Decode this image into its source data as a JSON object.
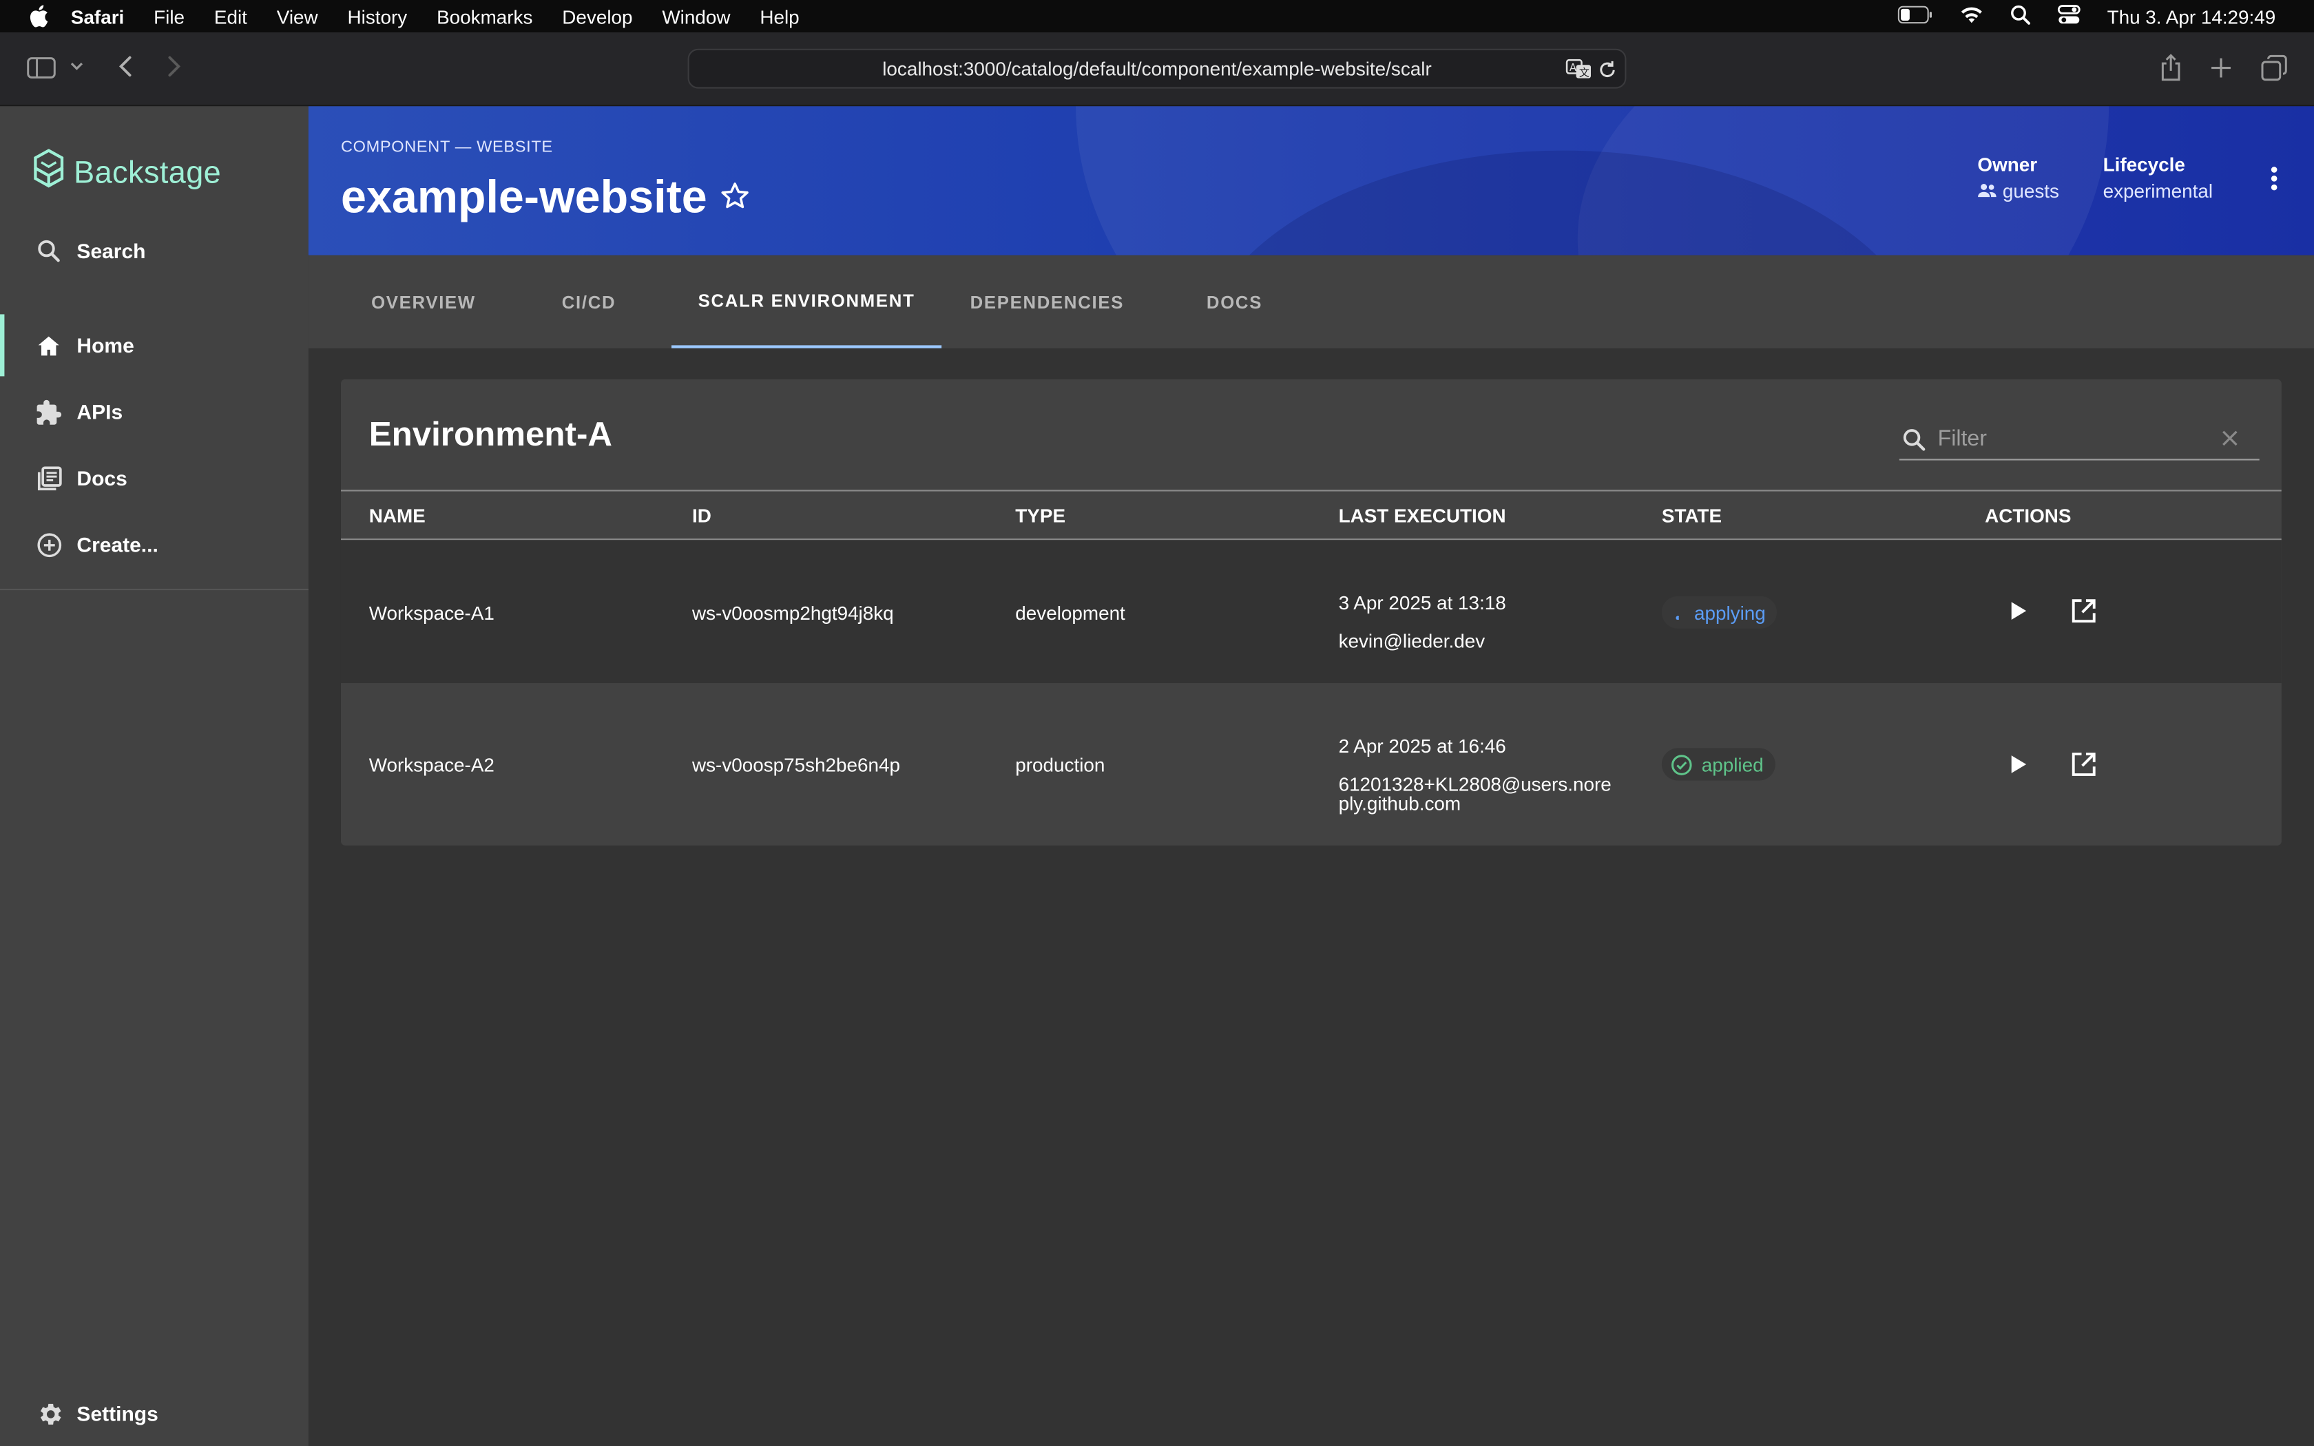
{
  "menubar": {
    "items": [
      "Safari",
      "File",
      "Edit",
      "View",
      "History",
      "Bookmarks",
      "Develop",
      "Window",
      "Help"
    ],
    "datetime": "Thu 3. Apr  14:29:49"
  },
  "browser": {
    "url": "localhost:3000/catalog/default/component/example-website/scalr"
  },
  "sidebar": {
    "brand": "Backstage",
    "search_label": "Search",
    "items": [
      {
        "label": "Home",
        "icon": "home-icon",
        "active": true
      },
      {
        "label": "APIs",
        "icon": "puzzle-icon"
      },
      {
        "label": "Docs",
        "icon": "library-icon"
      },
      {
        "label": "Create...",
        "icon": "add-circle-icon"
      }
    ],
    "settings_label": "Settings"
  },
  "header": {
    "kind": "COMPONENT — WEBSITE",
    "title": "example-website",
    "owner_label": "Owner",
    "owner_value": "guests",
    "lifecycle_label": "Lifecycle",
    "lifecycle_value": "experimental"
  },
  "tabs": [
    {
      "label": "OVERVIEW"
    },
    {
      "label": "CI/CD"
    },
    {
      "label": "SCALR ENVIRONMENT",
      "active": true
    },
    {
      "label": "DEPENDENCIES"
    },
    {
      "label": "DOCS"
    }
  ],
  "table": {
    "title": "Environment-A",
    "filter_placeholder": "Filter",
    "columns": [
      "NAME",
      "ID",
      "TYPE",
      "LAST EXECUTION",
      "STATE",
      "ACTIONS"
    ],
    "rows": [
      {
        "name": "Workspace-A1",
        "id": "ws-v0oosmp2hgt94j8kq",
        "type": "development",
        "exec_date": "3 Apr 2025 at 13:18",
        "exec_user": "kevin@lieder.dev",
        "exec_user_2": "",
        "state": "applying",
        "state_color": "#5b9cf5"
      },
      {
        "name": "Workspace-A2",
        "id": "ws-v0oosp75sh2be6n4p",
        "type": "production",
        "exec_date": "2 Apr 2025 at 16:46",
        "exec_user": "61201328+KL2808@users.nore",
        "exec_user_2": "ply.github.com",
        "state": "applied",
        "state_color": "#5fc48a"
      }
    ]
  },
  "colors": {
    "accent": "#9ef0d6",
    "tab_indicator": "#9cc9ff",
    "header_blue": "#1f3fb0"
  }
}
